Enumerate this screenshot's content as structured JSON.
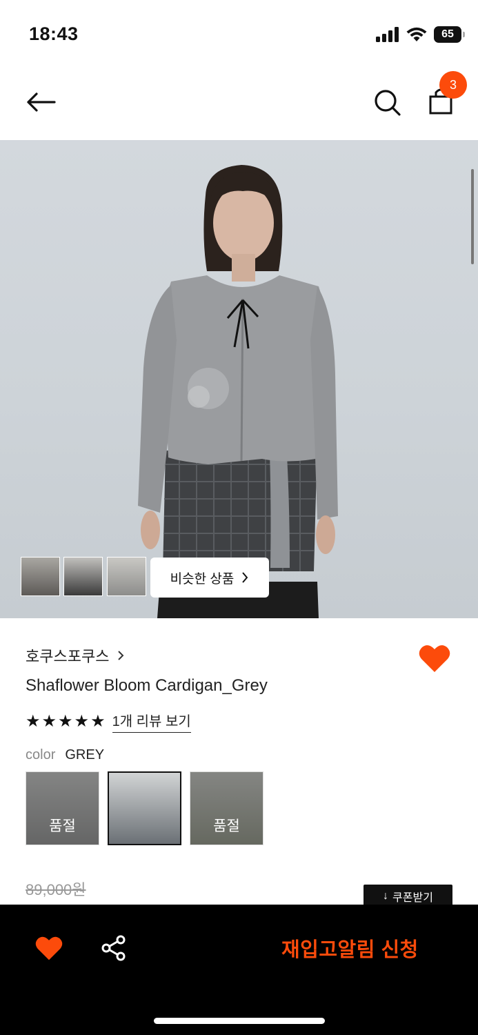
{
  "status": {
    "time": "18:43",
    "battery": "65"
  },
  "nav": {
    "cart_count": "3"
  },
  "gallery": {
    "similar_label": "비슷한 상품"
  },
  "product": {
    "brand": "호쿠스포쿠스",
    "name": "Shaflower Bloom Cardigan_Grey",
    "rating_stars": 5,
    "review_link": "1개 리뷰 보기",
    "color_label": "color",
    "color_value": "GREY",
    "swatches": [
      {
        "sold_out_label": "품절"
      },
      {
        "sold_out_label": ""
      },
      {
        "sold_out_label": "품절"
      }
    ],
    "original_price": "89,000원",
    "coupon_label": "쿠폰받기"
  },
  "bottom": {
    "restock_label": "재입고알림 신청"
  },
  "colors": {
    "accent": "#fc4b0b",
    "bar": "#000000"
  }
}
